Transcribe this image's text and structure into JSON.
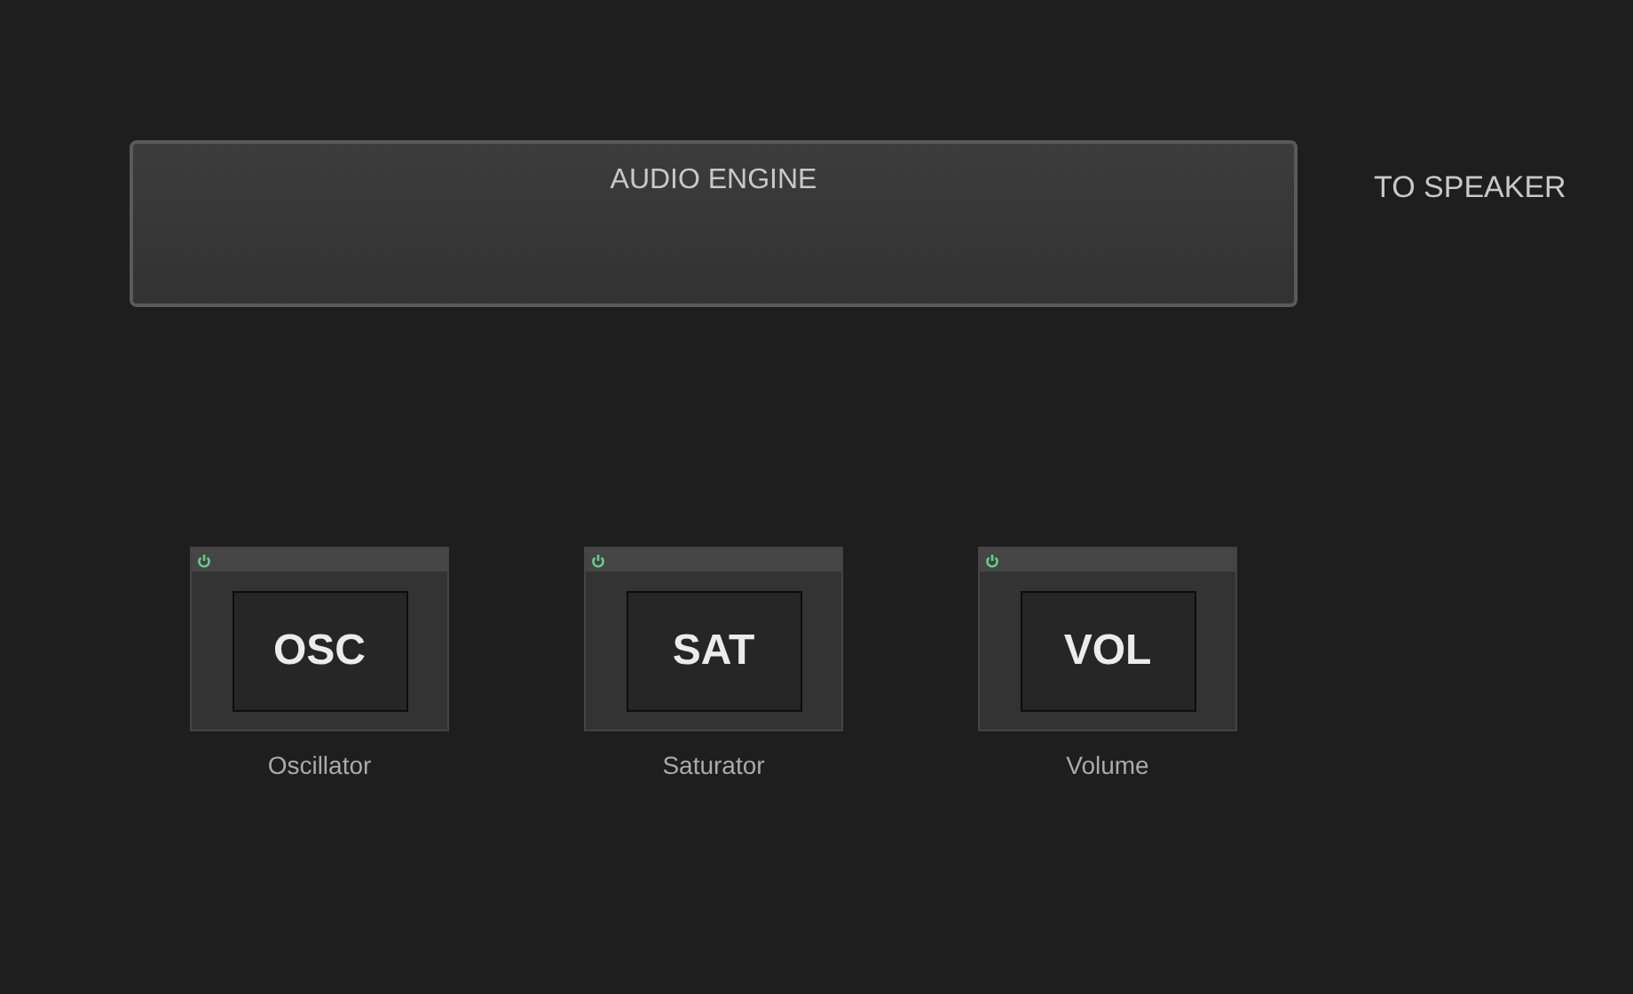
{
  "engine": {
    "title": "AUDIO ENGINE"
  },
  "output": {
    "label": "TO SPEAKER"
  },
  "modules": [
    {
      "code": "OSC",
      "name": "Oscillator",
      "on": true
    },
    {
      "code": "SAT",
      "name": "Saturator",
      "on": true
    },
    {
      "code": "VOL",
      "name": "Volume",
      "on": true
    }
  ]
}
